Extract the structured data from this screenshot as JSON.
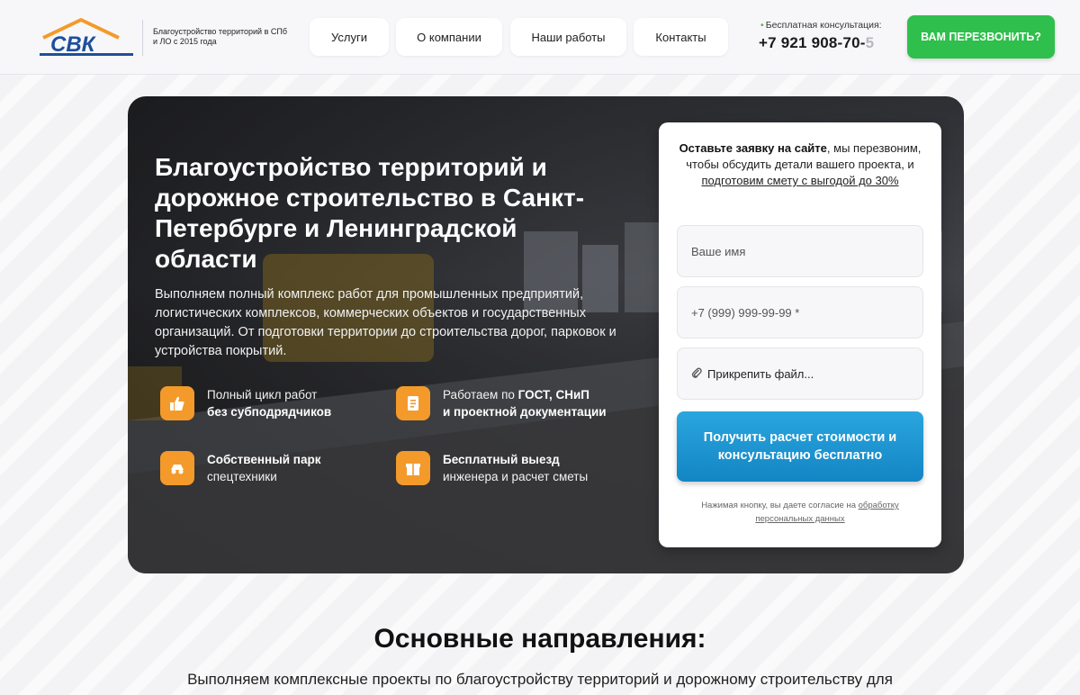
{
  "header": {
    "logo_text": "СВК",
    "tagline": "Благоустройство территорий в СПб и ЛО с 2015 года",
    "nav": [
      "Услуги",
      "О компании",
      "Наши работы",
      "Контакты"
    ],
    "consult_label": "Бесплатная консультация:",
    "phone_main": "+7 921 908-70-",
    "phone_fade": "5",
    "callback_label": "ВАМ ПЕРЕЗВОНИТЬ?"
  },
  "hero": {
    "title": "Благоустройство территорий и дорожное строительство в Санкт-Петербурге и Ленинградской области",
    "description": "Выполняем полный комплекс работ для промышленных предприятий, логистических комплексов, коммерческих объектов и государственных организаций. От подготовки территории до строительства дорог, парковок и устройства покрытий.",
    "features": [
      {
        "icon": "thumbs-up-icon",
        "line1": "Полный цикл работ",
        "line2": "без субподрядчиков"
      },
      {
        "icon": "document-icon",
        "line1_pre": "Работаем по ",
        "line1_bold": "ГОСТ, СНиП",
        "line2": "и проектной документации"
      },
      {
        "icon": "truck-icon",
        "line1": "Собственный парк",
        "line2": "спецтехники"
      },
      {
        "icon": "gift-icon",
        "line1": "Бесплатный выезд",
        "line2": "инженера и расчет сметы"
      }
    ]
  },
  "form": {
    "head_bold": "Оставьте заявку на сайте",
    "head_mid": ", мы перезвоним, чтобы обсудить детали вашего проекта, и ",
    "head_link": "подготовим смету с выгодой до 30%",
    "name_placeholder": "Ваше имя",
    "phone_placeholder": "+7 (999) 999-99-99 *",
    "attach_label": "Прикрепить файл...",
    "submit_label": "Получить расчет стоимости и консультацию бесплатно",
    "consent_text": "Нажимая кнопку, вы даете согласие на ",
    "consent_link": "обработку персональных данных"
  },
  "section": {
    "title": "Основные направления:",
    "desc": "Выполняем комплексные проекты по благоустройству территорий и дорожному строительству для"
  },
  "colors": {
    "accent_green": "#2fbf4c",
    "accent_orange": "#f39a2b",
    "accent_blue": "#1e96d3",
    "logo_blue": "#1d4f9c"
  }
}
